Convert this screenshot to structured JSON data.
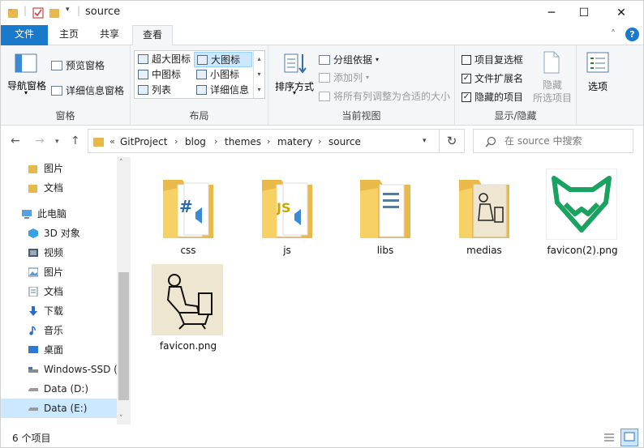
{
  "window": {
    "title": "source",
    "minimize": "─",
    "maximize": "☐",
    "close": "✕"
  },
  "ribbon": {
    "tabs": [
      "文件",
      "主页",
      "共享",
      "查看"
    ],
    "collapse": "˄",
    "help": "?",
    "groups": {
      "panes": {
        "label": "窗格",
        "nav_pane": "导航窗格",
        "preview_pane": "预览窗格",
        "details_pane": "详细信息窗格"
      },
      "layout": {
        "label": "布局",
        "items": [
          "超大图标",
          "大图标",
          "中图标",
          "小图标",
          "列表",
          "详细信息"
        ]
      },
      "current_view": {
        "label": "当前视图",
        "sort_by": "排序方式",
        "group_by": "分组依据",
        "add_columns": "添加列",
        "size_all_columns": "将所有列调整为合适的大小"
      },
      "show_hide": {
        "label": "显示/隐藏",
        "item_checkboxes": "项目复选框",
        "file_extensions": "文件扩展名",
        "hidden_items": "隐藏的项目",
        "hide_selected_1": "隐藏",
        "hide_selected_2": "所选项目",
        "options": "选项"
      }
    }
  },
  "address": {
    "overflow": "«",
    "crumbs": [
      "GitProject",
      "blog",
      "themes",
      "matery",
      "source"
    ],
    "search_placeholder": "在 source 中搜索"
  },
  "nav": {
    "items": [
      "图片",
      "文档",
      "此电脑",
      "3D 对象",
      "视频",
      "图片",
      "文档",
      "下载",
      "音乐",
      "桌面",
      "Windows-SSD (",
      "Data (D:)",
      "Data (E:)"
    ]
  },
  "files": [
    "css",
    "js",
    "libs",
    "medias",
    "favicon(2).png",
    "favicon.png"
  ],
  "status": {
    "count": "6 个项目"
  },
  "colors": {
    "accent": "#1979ca",
    "folder": "#f8d775",
    "favicon_green": "#1aa260"
  }
}
